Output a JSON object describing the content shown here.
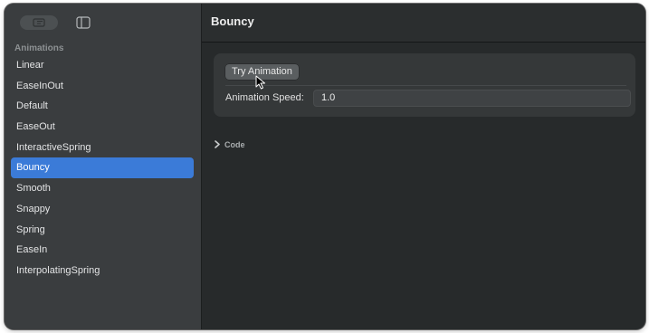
{
  "sidebar": {
    "section_title": "Animations",
    "items": [
      {
        "label": "Linear"
      },
      {
        "label": "EaseInOut"
      },
      {
        "label": "Default"
      },
      {
        "label": "EaseOut"
      },
      {
        "label": "InteractiveSpring"
      },
      {
        "label": "Bouncy",
        "selected": true
      },
      {
        "label": "Smooth"
      },
      {
        "label": "Snappy"
      },
      {
        "label": "Spring"
      },
      {
        "label": "EaseIn"
      },
      {
        "label": "InterpolatingSpring"
      }
    ]
  },
  "main": {
    "title": "Bouncy",
    "try_button": "Try Animation",
    "speed_label": "Animation Speed:",
    "speed_value": "1.0",
    "code_disclosure": "Code"
  },
  "icons": {
    "toolbar_left": "toolbar-pill-icon",
    "sidebar_toggle": "sidebar-toggle-icon",
    "disclosure": "chevron-right-icon",
    "cursor": "mouse-pointer-icon"
  },
  "colors": {
    "selection": "#3b7bd8",
    "window_bg": "#272a2b",
    "sidebar_bg": "#3a3d3f"
  }
}
